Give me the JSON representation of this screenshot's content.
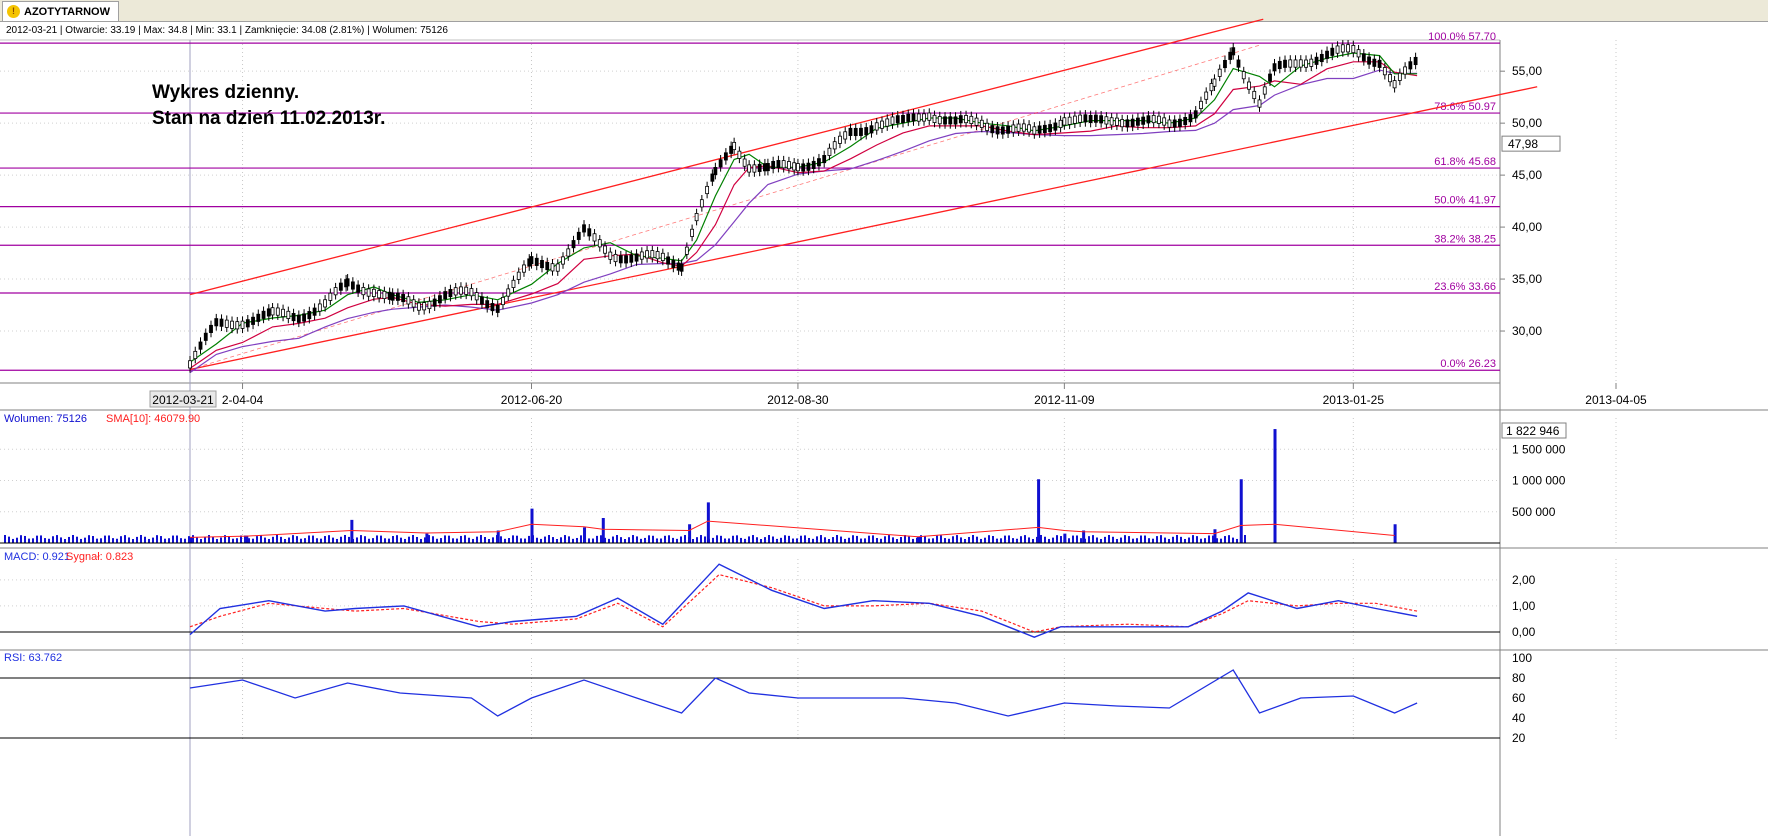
{
  "window": {
    "tab_title": "AZOTYTARNOW"
  },
  "infobar": {
    "text": "2012-03-21 | Otwarcie: 33.19 | Max: 34.8 | Min: 33.1 | Zamknięcie: 34.08 (2.81%) | Wolumen: 75126"
  },
  "annotation": {
    "line1": "Wykres dzienny.",
    "line2": "Stan na dzień 11.02.2013r."
  },
  "colors": {
    "fib": "#a000a0",
    "channel": "#ff2020",
    "volume": "#1010d0",
    "macd": "#2030e0",
    "signal": "#ff2020",
    "rsi": "#2030e0",
    "sma_fast": "#008000",
    "sma_mid": "#d00040",
    "sma_slow": "#8040c0"
  },
  "chart_data": [
    {
      "type": "candlestick",
      "title": "AZOTYTARNOW",
      "x_dates": [
        "2012-03-21",
        "2012-04-04",
        "2012-06-20",
        "2012-08-30",
        "2012-11-09",
        "2013-01-25",
        "2013-04-05"
      ],
      "x_tick_labels": [
        "2012-03-21",
        "2-04-04",
        "2012-06-20",
        "2012-08-30",
        "2012-11-09",
        "2013-01-25",
        "2013-04-05"
      ],
      "ylim": [
        25,
        58
      ],
      "y_ticks": [
        "55,00",
        "50,00",
        "45,00",
        "40,00",
        "35,00",
        "30,00"
      ],
      "y_tick_values": [
        55,
        50,
        45,
        40,
        35,
        30
      ],
      "last_price_label": "47,98",
      "fibonacci": [
        {
          "label": "100.0% 57.70",
          "value": 57.7
        },
        {
          "label": "78.6% 50.97",
          "value": 50.97
        },
        {
          "label": "61.8% 45.68",
          "value": 45.68
        },
        {
          "label": "50.0% 41.97",
          "value": 41.97
        },
        {
          "label": "38.2% 38.25",
          "value": 38.25
        },
        {
          "label": "23.6% 33.66",
          "value": 33.66
        },
        {
          "label": "0.0% 26.23",
          "value": 26.23
        }
      ],
      "close_path": [
        [
          "2012-03-21",
          27.0
        ],
        [
          "2012-03-28",
          30.5
        ],
        [
          "2012-04-04",
          31.0
        ],
        [
          "2012-04-12",
          31.5
        ],
        [
          "2012-04-19",
          31.5
        ],
        [
          "2012-04-26",
          32.5
        ],
        [
          "2012-05-02",
          34.5
        ],
        [
          "2012-05-09",
          34.0
        ],
        [
          "2012-05-14",
          33.0
        ],
        [
          "2012-05-21",
          32.5
        ],
        [
          "2012-05-28",
          33.5
        ],
        [
          "2012-06-04",
          33.5
        ],
        [
          "2012-06-11",
          32.5
        ],
        [
          "2012-06-20",
          36.5
        ],
        [
          "2012-06-27",
          36.5
        ],
        [
          "2012-07-04",
          39.5
        ],
        [
          "2012-07-11",
          37.5
        ],
        [
          "2012-07-18",
          37.0
        ],
        [
          "2012-07-25",
          37.0
        ],
        [
          "2012-07-30",
          36.5
        ],
        [
          "2012-08-03",
          41.0
        ],
        [
          "2012-08-08",
          45.0
        ],
        [
          "2012-08-13",
          48.0
        ],
        [
          "2012-08-17",
          46.0
        ],
        [
          "2012-08-22",
          45.5
        ],
        [
          "2012-08-30",
          46.0
        ],
        [
          "2012-09-06",
          46.5
        ],
        [
          "2012-09-13",
          49.0
        ],
        [
          "2012-09-20",
          50.0
        ],
        [
          "2012-09-27",
          50.0
        ],
        [
          "2012-10-04",
          51.0
        ],
        [
          "2012-10-11",
          50.0
        ],
        [
          "2012-10-18",
          50.0
        ],
        [
          "2012-10-25",
          49.5
        ],
        [
          "2012-11-01",
          49.0
        ],
        [
          "2012-11-09",
          50.5
        ],
        [
          "2012-11-16",
          50.0
        ],
        [
          "2012-11-23",
          50.5
        ],
        [
          "2012-11-30",
          50.0
        ],
        [
          "2012-12-07",
          50.0
        ],
        [
          "2012-12-14",
          51.0
        ],
        [
          "2012-12-19",
          53.5
        ],
        [
          "2012-12-24",
          57.0
        ],
        [
          "2012-12-31",
          52.0
        ],
        [
          "2013-01-04",
          55.0
        ],
        [
          "2013-01-11",
          56.0
        ],
        [
          "2013-01-18",
          56.5
        ],
        [
          "2013-01-25",
          57.0
        ],
        [
          "2013-02-01",
          56.0
        ],
        [
          "2013-02-05",
          53.5
        ],
        [
          "2013-02-11",
          56.0
        ]
      ],
      "channel_upper": [
        [
          "2012-03-21",
          33.5
        ],
        [
          "2013-01-01",
          60.0
        ]
      ],
      "channel_lower": [
        [
          "2012-03-21",
          26.3
        ],
        [
          "2013-03-15",
          53.5
        ]
      ]
    },
    {
      "type": "bar",
      "title": "Wolumen",
      "legend": [
        {
          "name": "Wolumen: 75126",
          "color": "#1010d0"
        },
        {
          "name": "SMA[10]: 46079.90",
          "color": "#ff2020"
        }
      ],
      "ylim": [
        0,
        2000000
      ],
      "y_ticks": [
        "1 500 000",
        "1 000 000",
        "500 000"
      ],
      "y_tick_values": [
        1500000,
        1000000,
        500000
      ],
      "max_label": "1 822 946",
      "x_dates": [
        "2012-03-21",
        "2012-04-05",
        "2012-05-03",
        "2012-05-23",
        "2012-06-11",
        "2012-06-20",
        "2012-07-04",
        "2012-07-09",
        "2012-08-01",
        "2012-08-06",
        "2012-10-01",
        "2012-11-02",
        "2012-11-09",
        "2012-11-14",
        "2012-12-19",
        "2012-12-26",
        "2013-01-04",
        "2013-02-05"
      ],
      "values": [
        90000,
        120000,
        370000,
        150000,
        200000,
        550000,
        250000,
        400000,
        300000,
        650000,
        100000,
        1020000,
        150000,
        200000,
        220000,
        1020000,
        1822946,
        300000
      ],
      "sma_values": [
        90000,
        110000,
        200000,
        160000,
        180000,
        300000,
        260000,
        220000,
        200000,
        350000,
        100000,
        250000,
        200000,
        180000,
        150000,
        280000,
        300000,
        120000
      ]
    },
    {
      "type": "line",
      "title": "MACD",
      "legend": [
        {
          "name": "MACD: 0.921",
          "color": "#2030e0"
        },
        {
          "name": "Sygnał: 0.823",
          "color": "#ff2020"
        }
      ],
      "ylim": [
        -0.5,
        2.8
      ],
      "y_ticks": [
        "2,00",
        "1,00",
        "0,00"
      ],
      "y_tick_values": [
        2.0,
        1.0,
        0.0
      ],
      "x_dates": [
        "2012-03-21",
        "2012-03-29",
        "2012-04-11",
        "2012-04-26",
        "2012-05-04",
        "2012-05-17",
        "2012-06-06",
        "2012-06-15",
        "2012-07-02",
        "2012-07-13",
        "2012-07-25",
        "2012-08-09",
        "2012-08-23",
        "2012-09-06",
        "2012-09-19",
        "2012-10-04",
        "2012-10-18",
        "2012-11-01",
        "2012-11-08",
        "2012-11-26",
        "2012-12-12",
        "2012-12-21",
        "2012-12-28",
        "2013-01-10",
        "2013-01-21",
        "2013-01-31",
        "2013-02-11"
      ],
      "macd": [
        -0.1,
        0.9,
        1.2,
        0.8,
        0.9,
        1.0,
        0.2,
        0.4,
        0.6,
        1.3,
        0.3,
        2.6,
        1.6,
        0.9,
        1.2,
        1.1,
        0.6,
        -0.2,
        0.2,
        0.2,
        0.2,
        0.8,
        1.5,
        0.9,
        1.2,
        0.9,
        0.6
      ],
      "signal": [
        0.2,
        0.6,
        1.1,
        0.9,
        0.8,
        0.9,
        0.4,
        0.3,
        0.5,
        1.1,
        0.2,
        2.2,
        1.7,
        1.0,
        1.0,
        1.1,
        0.8,
        0.0,
        0.2,
        0.3,
        0.2,
        0.7,
        1.2,
        1.0,
        1.1,
        1.1,
        0.8
      ]
    },
    {
      "type": "line",
      "title": "RSI",
      "legend": [
        {
          "name": "RSI: 63.762",
          "color": "#2030e0"
        }
      ],
      "ylim": [
        18,
        100
      ],
      "y_ticks": [
        "100",
        "80",
        "60",
        "40",
        "20"
      ],
      "y_tick_values": [
        100,
        80,
        60,
        40,
        20
      ],
      "levels": [
        80,
        20
      ],
      "x_dates": [
        "2012-03-21",
        "2012-04-04",
        "2012-04-18",
        "2012-05-02",
        "2012-05-16",
        "2012-06-04",
        "2012-06-11",
        "2012-06-20",
        "2012-07-04",
        "2012-07-18",
        "2012-07-30",
        "2012-08-08",
        "2012-08-17",
        "2012-08-30",
        "2012-09-13",
        "2012-09-27",
        "2012-10-11",
        "2012-10-25",
        "2012-11-09",
        "2012-11-23",
        "2012-12-07",
        "2012-12-24",
        "2012-12-31",
        "2013-01-11",
        "2013-01-25",
        "2013-02-05",
        "2013-02-11"
      ],
      "values": [
        70,
        78,
        60,
        75,
        65,
        60,
        42,
        60,
        78,
        60,
        45,
        80,
        65,
        60,
        60,
        60,
        55,
        42,
        55,
        52,
        50,
        88,
        45,
        60,
        62,
        45,
        55
      ]
    }
  ]
}
